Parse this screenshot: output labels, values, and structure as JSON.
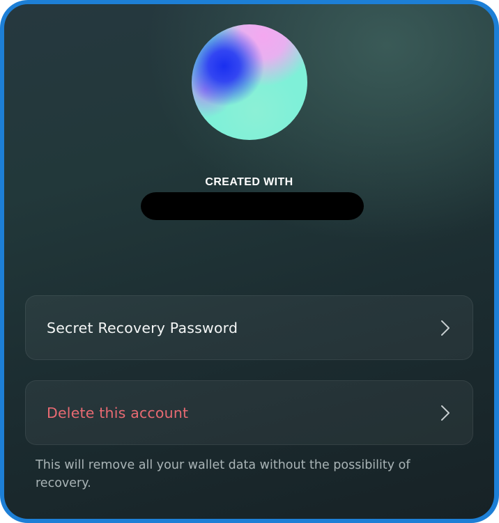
{
  "account": {
    "created_label": "CREATED WITH",
    "created_value_redacted": true
  },
  "options": {
    "recovery_label": "Secret Recovery Password",
    "delete_label": "Delete this account"
  },
  "note": {
    "text": "This will remove all your wallet data without the possibility of recovery."
  },
  "icons": {
    "avatar": "gradient-avatar",
    "recovery_chevron": "chevron-right-icon",
    "delete_chevron": "chevron-right-icon"
  },
  "colors": {
    "frame_border": "#1d7fd6",
    "delete_text": "#e86a72",
    "note_text": "#a9b4b6"
  }
}
